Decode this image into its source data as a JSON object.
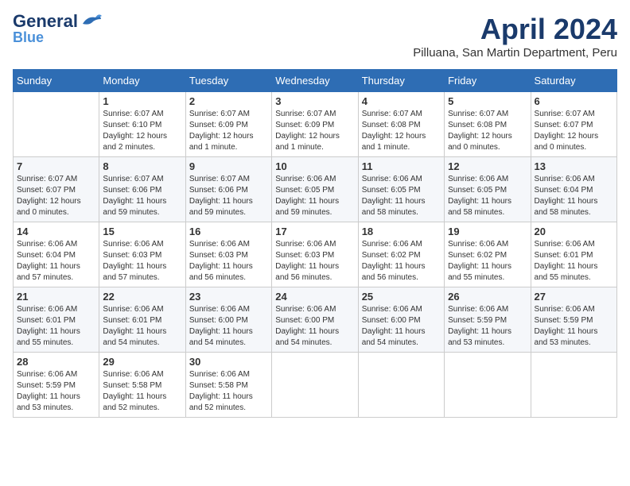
{
  "header": {
    "logo_line1": "General",
    "logo_line2": "Blue",
    "month_title": "April 2024",
    "location": "Pilluana, San Martin Department, Peru"
  },
  "days_of_week": [
    "Sunday",
    "Monday",
    "Tuesday",
    "Wednesday",
    "Thursday",
    "Friday",
    "Saturday"
  ],
  "weeks": [
    [
      {
        "day": "",
        "info": ""
      },
      {
        "day": "1",
        "info": "Sunrise: 6:07 AM\nSunset: 6:10 PM\nDaylight: 12 hours\nand 2 minutes."
      },
      {
        "day": "2",
        "info": "Sunrise: 6:07 AM\nSunset: 6:09 PM\nDaylight: 12 hours\nand 1 minute."
      },
      {
        "day": "3",
        "info": "Sunrise: 6:07 AM\nSunset: 6:09 PM\nDaylight: 12 hours\nand 1 minute."
      },
      {
        "day": "4",
        "info": "Sunrise: 6:07 AM\nSunset: 6:08 PM\nDaylight: 12 hours\nand 1 minute."
      },
      {
        "day": "5",
        "info": "Sunrise: 6:07 AM\nSunset: 6:08 PM\nDaylight: 12 hours\nand 0 minutes."
      },
      {
        "day": "6",
        "info": "Sunrise: 6:07 AM\nSunset: 6:07 PM\nDaylight: 12 hours\nand 0 minutes."
      }
    ],
    [
      {
        "day": "7",
        "info": "Sunrise: 6:07 AM\nSunset: 6:07 PM\nDaylight: 12 hours\nand 0 minutes."
      },
      {
        "day": "8",
        "info": "Sunrise: 6:07 AM\nSunset: 6:06 PM\nDaylight: 11 hours\nand 59 minutes."
      },
      {
        "day": "9",
        "info": "Sunrise: 6:07 AM\nSunset: 6:06 PM\nDaylight: 11 hours\nand 59 minutes."
      },
      {
        "day": "10",
        "info": "Sunrise: 6:06 AM\nSunset: 6:05 PM\nDaylight: 11 hours\nand 59 minutes."
      },
      {
        "day": "11",
        "info": "Sunrise: 6:06 AM\nSunset: 6:05 PM\nDaylight: 11 hours\nand 58 minutes."
      },
      {
        "day": "12",
        "info": "Sunrise: 6:06 AM\nSunset: 6:05 PM\nDaylight: 11 hours\nand 58 minutes."
      },
      {
        "day": "13",
        "info": "Sunrise: 6:06 AM\nSunset: 6:04 PM\nDaylight: 11 hours\nand 58 minutes."
      }
    ],
    [
      {
        "day": "14",
        "info": "Sunrise: 6:06 AM\nSunset: 6:04 PM\nDaylight: 11 hours\nand 57 minutes."
      },
      {
        "day": "15",
        "info": "Sunrise: 6:06 AM\nSunset: 6:03 PM\nDaylight: 11 hours\nand 57 minutes."
      },
      {
        "day": "16",
        "info": "Sunrise: 6:06 AM\nSunset: 6:03 PM\nDaylight: 11 hours\nand 56 minutes."
      },
      {
        "day": "17",
        "info": "Sunrise: 6:06 AM\nSunset: 6:03 PM\nDaylight: 11 hours\nand 56 minutes."
      },
      {
        "day": "18",
        "info": "Sunrise: 6:06 AM\nSunset: 6:02 PM\nDaylight: 11 hours\nand 56 minutes."
      },
      {
        "day": "19",
        "info": "Sunrise: 6:06 AM\nSunset: 6:02 PM\nDaylight: 11 hours\nand 55 minutes."
      },
      {
        "day": "20",
        "info": "Sunrise: 6:06 AM\nSunset: 6:01 PM\nDaylight: 11 hours\nand 55 minutes."
      }
    ],
    [
      {
        "day": "21",
        "info": "Sunrise: 6:06 AM\nSunset: 6:01 PM\nDaylight: 11 hours\nand 55 minutes."
      },
      {
        "day": "22",
        "info": "Sunrise: 6:06 AM\nSunset: 6:01 PM\nDaylight: 11 hours\nand 54 minutes."
      },
      {
        "day": "23",
        "info": "Sunrise: 6:06 AM\nSunset: 6:00 PM\nDaylight: 11 hours\nand 54 minutes."
      },
      {
        "day": "24",
        "info": "Sunrise: 6:06 AM\nSunset: 6:00 PM\nDaylight: 11 hours\nand 54 minutes."
      },
      {
        "day": "25",
        "info": "Sunrise: 6:06 AM\nSunset: 6:00 PM\nDaylight: 11 hours\nand 54 minutes."
      },
      {
        "day": "26",
        "info": "Sunrise: 6:06 AM\nSunset: 5:59 PM\nDaylight: 11 hours\nand 53 minutes."
      },
      {
        "day": "27",
        "info": "Sunrise: 6:06 AM\nSunset: 5:59 PM\nDaylight: 11 hours\nand 53 minutes."
      }
    ],
    [
      {
        "day": "28",
        "info": "Sunrise: 6:06 AM\nSunset: 5:59 PM\nDaylight: 11 hours\nand 53 minutes."
      },
      {
        "day": "29",
        "info": "Sunrise: 6:06 AM\nSunset: 5:58 PM\nDaylight: 11 hours\nand 52 minutes."
      },
      {
        "day": "30",
        "info": "Sunrise: 6:06 AM\nSunset: 5:58 PM\nDaylight: 11 hours\nand 52 minutes."
      },
      {
        "day": "",
        "info": ""
      },
      {
        "day": "",
        "info": ""
      },
      {
        "day": "",
        "info": ""
      },
      {
        "day": "",
        "info": ""
      }
    ]
  ]
}
